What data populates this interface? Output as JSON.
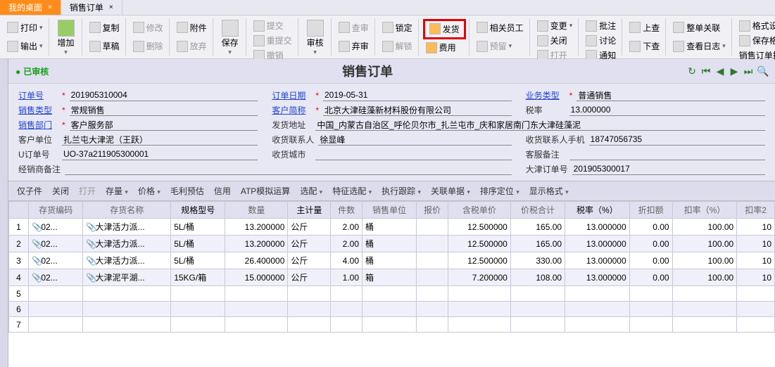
{
  "tabs": {
    "t0": "我的桌面",
    "t1": "销售订单"
  },
  "ribbon": {
    "print": "打印",
    "output": "输出",
    "add": "增加",
    "copy": "复制",
    "draft": "草稿",
    "modify": "修改",
    "delete": "删除",
    "attach": "附件",
    "abandon": "放弃",
    "save": "保存",
    "submit": "提交",
    "resubmit": "重提交",
    "revoke": "撤销",
    "audit": "审核",
    "review": "查审",
    "giveup": "弃审",
    "lock": "锁定",
    "unlock": "解锁",
    "ship": "发货",
    "fee": "费用",
    "related": "相关员工",
    "reserve": "预留",
    "change": "变更",
    "close": "关闭",
    "open": "打开",
    "batch": "批注",
    "discuss": "讨论",
    "notify": "通知",
    "up": "上查",
    "down": "下查",
    "whole": "整单关联",
    "log": "查看日志",
    "fmt": "格式设置",
    "savefmt": "保存格式",
    "tpl": "销售订单打印模版"
  },
  "header": {
    "status": "已审核",
    "title": "销售订单"
  },
  "form": {
    "order_no_l": "订单号",
    "order_no": "201905310004",
    "date_l": "订单日期",
    "date": "2019-05-31",
    "biztype_l": "业务类型",
    "biztype": "普通销售",
    "saletype_l": "销售类型",
    "saletype": "常规销售",
    "cust_abbr_l": "客户简称",
    "cust_abbr": "北京大津硅藻新材料股份有限公司",
    "taxrate_l": "税率",
    "taxrate": "13.000000",
    "dept_l": "销售部门",
    "dept": "客户服务部",
    "ship_addr_l": "发货地址",
    "ship_addr": "中国_内蒙古自治区_呼伦贝尔市_扎兰屯市_庆和家居南门东大津硅藻泥",
    "cust_unit_l": "客户单位",
    "cust_unit": "扎兰屯大津泥（王跃）",
    "recv_contact_l": "收货联系人",
    "recv_contact": "徐显峰",
    "recv_phone_l": "收货联系人手机",
    "recv_phone": "18747056735",
    "uorder_l": "U订单号",
    "uorder": "UO-37a211905300001",
    "recv_city_l": "收货城市",
    "recv_city": "",
    "cust_remark_l": "客服备注",
    "cust_remark": "",
    "dealer_remark_l": "经销商备注",
    "dealer_remark": "",
    "dj_order_l": "大津订单号",
    "dj_order": "201905300017"
  },
  "gridbar": {
    "only": "仅子件",
    "close": "关闭",
    "open": "打开",
    "stock": "存量",
    "price": "价格",
    "gross": "毛利预估",
    "credit": "信用",
    "atp": "ATP模拟运算",
    "assort": "选配",
    "feature": "特征选配",
    "track": "执行跟踪",
    "relate": "关联单据",
    "sort": "排序定位",
    "display": "显示格式"
  },
  "cols": {
    "c0": "",
    "c1": "存货编码",
    "c2": "存货名称",
    "c3": "规格型号",
    "c4": "数量",
    "c5": "主计量",
    "c6": "件数",
    "c7": "销售单位",
    "c8": "报价",
    "c9": "含税单价",
    "c10": "价税合计",
    "c11": "税率（%）",
    "c12": "折扣额",
    "c13": "扣率（%）",
    "c14": "扣率2"
  },
  "rows": [
    {
      "n": "1",
      "code": "02...",
      "name": "大津活力派...",
      "spec": "5L/桶",
      "qty": "13.200000",
      "unit": "公斤",
      "pcs": "2.00",
      "sunit": "桶",
      "quote": "",
      "tax_price": "12.500000",
      "total": "165.00",
      "taxr": "13.000000",
      "disc": "0.00",
      "rate": "100.00",
      "rate2": "10"
    },
    {
      "n": "2",
      "code": "02...",
      "name": "大津活力派...",
      "spec": "5L/桶",
      "qty": "13.200000",
      "unit": "公斤",
      "pcs": "2.00",
      "sunit": "桶",
      "quote": "",
      "tax_price": "12.500000",
      "total": "165.00",
      "taxr": "13.000000",
      "disc": "0.00",
      "rate": "100.00",
      "rate2": "10"
    },
    {
      "n": "3",
      "code": "02...",
      "name": "大津活力派...",
      "spec": "5L/桶",
      "qty": "26.400000",
      "unit": "公斤",
      "pcs": "4.00",
      "sunit": "桶",
      "quote": "",
      "tax_price": "12.500000",
      "total": "330.00",
      "taxr": "13.000000",
      "disc": "0.00",
      "rate": "100.00",
      "rate2": "10"
    },
    {
      "n": "4",
      "code": "02...",
      "name": "大津泥平湖...",
      "spec": "15KG/箱",
      "qty": "15.000000",
      "unit": "公斤",
      "pcs": "1.00",
      "sunit": "箱",
      "quote": "",
      "tax_price": "7.200000",
      "total": "108.00",
      "taxr": "13.000000",
      "disc": "0.00",
      "rate": "100.00",
      "rate2": "10"
    },
    {
      "n": "5"
    },
    {
      "n": "6"
    },
    {
      "n": "7"
    }
  ]
}
